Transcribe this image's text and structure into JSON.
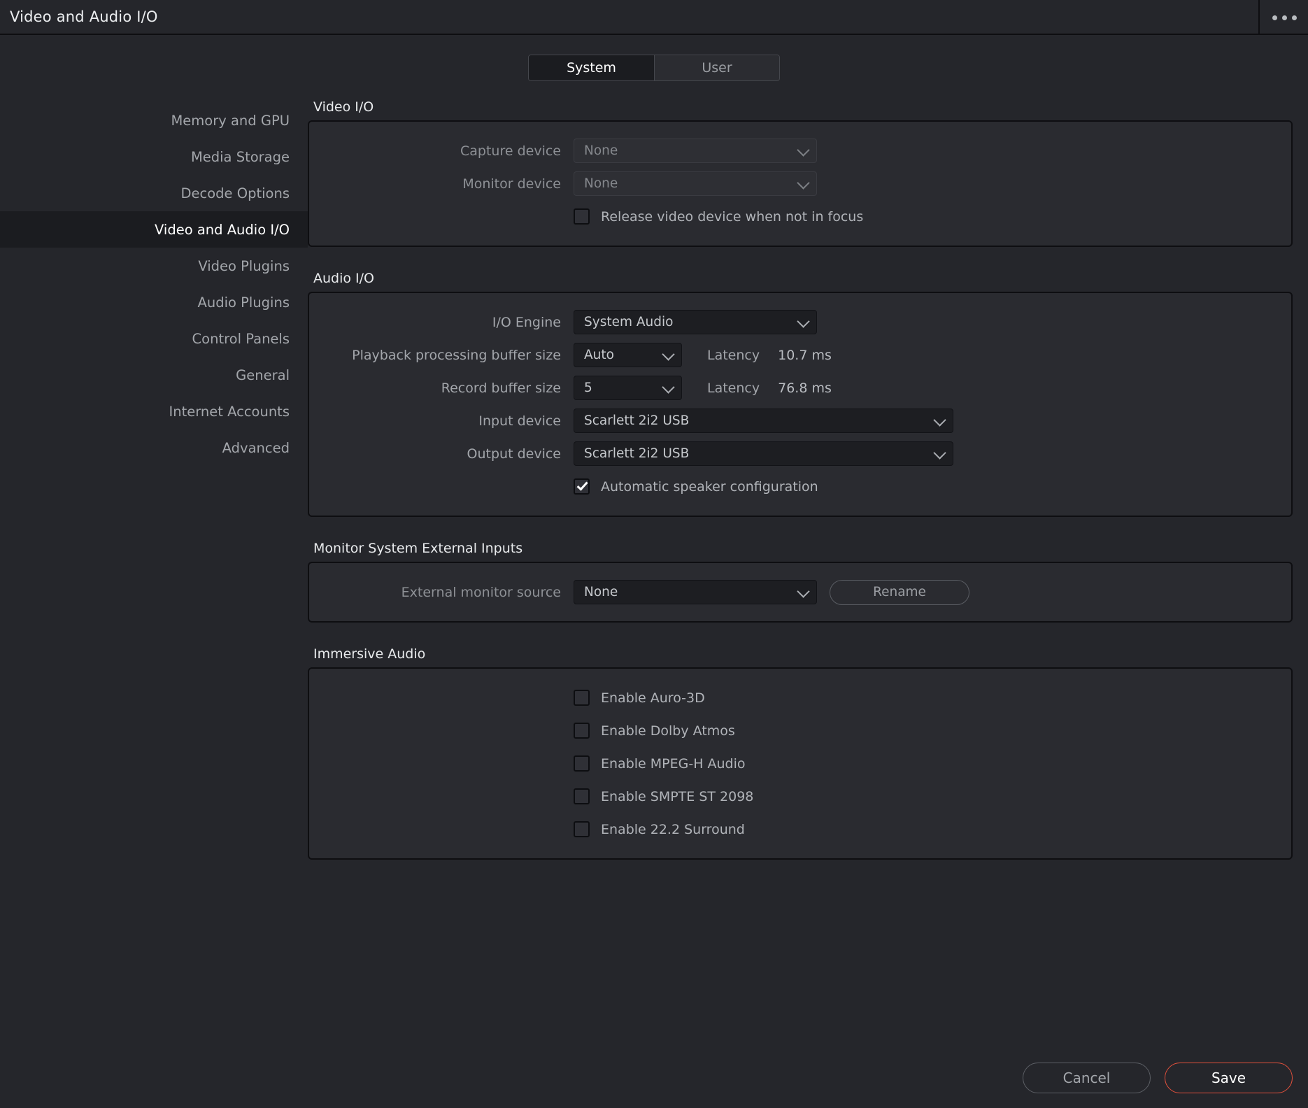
{
  "window": {
    "title": "Video and Audio I/O",
    "menu_icon": "ellipsis-icon"
  },
  "tabs": [
    {
      "label": "System",
      "active": true
    },
    {
      "label": "User",
      "active": false
    }
  ],
  "sidebar": {
    "items": [
      {
        "label": "Memory and GPU",
        "active": false
      },
      {
        "label": "Media Storage",
        "active": false
      },
      {
        "label": "Decode Options",
        "active": false
      },
      {
        "label": "Video and Audio I/O",
        "active": true
      },
      {
        "label": "Video Plugins",
        "active": false
      },
      {
        "label": "Audio Plugins",
        "active": false
      },
      {
        "label": "Control Panels",
        "active": false
      },
      {
        "label": "General",
        "active": false
      },
      {
        "label": "Internet Accounts",
        "active": false
      },
      {
        "label": "Advanced",
        "active": false
      }
    ]
  },
  "video_io": {
    "section_title": "Video I/O",
    "capture_device": {
      "label": "Capture device",
      "value": "None",
      "disabled": true
    },
    "monitor_device": {
      "label": "Monitor device",
      "value": "None",
      "disabled": true
    },
    "release_video": {
      "label": "Release video device when not in focus",
      "checked": false
    }
  },
  "audio_io": {
    "section_title": "Audio I/O",
    "io_engine": {
      "label": "I/O Engine",
      "value": "System Audio"
    },
    "playback_buffer": {
      "label": "Playback processing buffer size",
      "value": "Auto",
      "latency_label": "Latency",
      "latency_value": "10.7 ms"
    },
    "record_buffer": {
      "label": "Record buffer size",
      "value": "5",
      "latency_label": "Latency",
      "latency_value": "76.8 ms"
    },
    "input_device": {
      "label": "Input device",
      "value": "Scarlett 2i2 USB"
    },
    "output_device": {
      "label": "Output device",
      "value": "Scarlett 2i2 USB"
    },
    "auto_speaker": {
      "label": "Automatic speaker configuration",
      "checked": true
    }
  },
  "monitor_external": {
    "section_title": "Monitor System External Inputs",
    "external_source": {
      "label": "External monitor source",
      "value": "None"
    },
    "rename_label": "Rename"
  },
  "immersive_audio": {
    "section_title": "Immersive Audio",
    "options": [
      {
        "label": "Enable Auro-3D",
        "checked": false
      },
      {
        "label": "Enable Dolby Atmos",
        "checked": false
      },
      {
        "label": "Enable MPEG-H Audio",
        "checked": false
      },
      {
        "label": "Enable SMPTE ST 2098",
        "checked": false
      },
      {
        "label": "Enable 22.2 Surround",
        "checked": false
      }
    ]
  },
  "footer": {
    "cancel_label": "Cancel",
    "save_label": "Save",
    "save_accent": "#e0503c"
  }
}
